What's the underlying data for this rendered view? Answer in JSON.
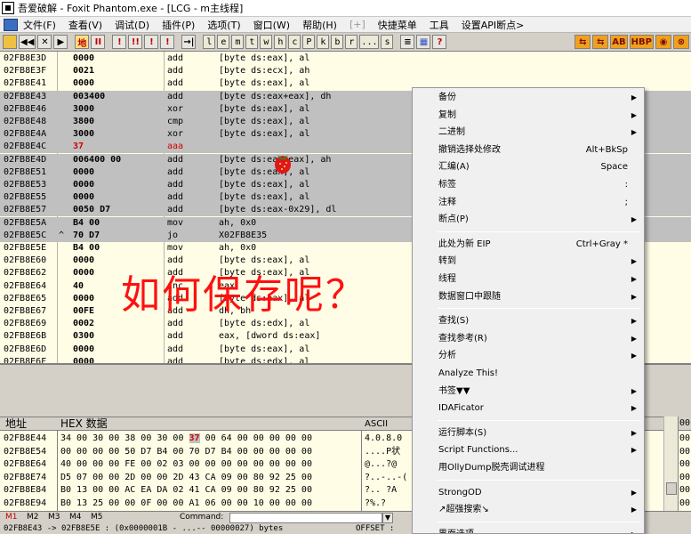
{
  "window": {
    "title": "吾爱破解 - Foxit Phantom.exe - [LCG - m主线程]"
  },
  "menubar": {
    "items": [
      "文件(F)",
      "查看(V)",
      "调试(D)",
      "插件(P)",
      "选项(T)",
      "窗口(W)",
      "帮助(H)",
      "[+]",
      "快捷菜单",
      "工具",
      "设置API断点>"
    ]
  },
  "toolbar": {
    "buttons": [
      "地",
      "II",
      "!",
      "!!",
      "!",
      "!",
      "→|",
      "l",
      "e",
      "m",
      "t",
      "w",
      "h",
      "c",
      "P",
      "k",
      "b",
      "r",
      "...",
      "s",
      "≡",
      "?"
    ],
    "plugin_buttons": [
      "⇆",
      "⇆",
      "AB",
      "HBP",
      "◉",
      "⊗"
    ]
  },
  "disassembly": {
    "rows": [
      {
        "addr": "02FB8E3D",
        "mark": "",
        "hex": "0000",
        "mnem": "add",
        "ops": "[byte ds:eax], al",
        "sel": false,
        "red": false
      },
      {
        "addr": "02FB8E3F",
        "mark": "",
        "hex": "0021",
        "mnem": "add",
        "ops": "[byte ds:ecx], ah",
        "sel": false,
        "red": false
      },
      {
        "addr": "02FB8E41",
        "mark": "",
        "hex": "0000",
        "mnem": "add",
        "ops": "[byte ds:eax], al",
        "sel": false,
        "red": false
      },
      {
        "addr": "02FB8E43",
        "mark": "",
        "hex": "003400",
        "mnem": "add",
        "ops": "[byte ds:eax+eax], dh",
        "sel": true,
        "red": false
      },
      {
        "addr": "02FB8E46",
        "mark": "",
        "hex": "3000",
        "mnem": "xor",
        "ops": "[byte ds:eax], al",
        "sel": true,
        "red": false
      },
      {
        "addr": "02FB8E48",
        "mark": "",
        "hex": "3800",
        "mnem": "cmp",
        "ops": "[byte ds:eax], al",
        "sel": true,
        "red": false
      },
      {
        "addr": "02FB8E4A",
        "mark": "",
        "hex": "3000",
        "mnem": "xor",
        "ops": "[byte ds:eax], al",
        "sel": true,
        "red": false
      },
      {
        "addr": "02FB8E4C",
        "mark": "",
        "hex": "37",
        "mnem": "aaa",
        "ops": "",
        "sel": true,
        "red": true
      },
      {
        "addr": "02FB8E4D",
        "mark": "",
        "hex": "006400 00",
        "mnem": "add",
        "ops": "[byte ds:eax+eax], ah",
        "sel": true,
        "red": false
      },
      {
        "addr": "02FB8E51",
        "mark": "",
        "hex": "0000",
        "mnem": "add",
        "ops": "[byte ds:eax], al",
        "sel": true,
        "red": false
      },
      {
        "addr": "02FB8E53",
        "mark": "",
        "hex": "0000",
        "mnem": "add",
        "ops": "[byte ds:eax], al",
        "sel": true,
        "red": false
      },
      {
        "addr": "02FB8E55",
        "mark": "",
        "hex": "0000",
        "mnem": "add",
        "ops": "[byte ds:eax], al",
        "sel": true,
        "red": false
      },
      {
        "addr": "02FB8E57",
        "mark": "",
        "hex": "0050 D7",
        "mnem": "add",
        "ops": "[byte ds:eax-0x29], dl",
        "sel": true,
        "red": false
      },
      {
        "addr": "02FB8E5A",
        "mark": "",
        "hex": "B4 00",
        "mnem": "mov",
        "ops": "ah, 0x0",
        "sel": true,
        "red": false
      },
      {
        "addr": "02FB8E5C",
        "mark": "^",
        "hex": "70 D7",
        "mnem": "jo",
        "ops": "X02FB8E35",
        "sel": true,
        "red": false
      },
      {
        "addr": "02FB8E5E",
        "mark": "",
        "hex": "B4 00",
        "mnem": "mov",
        "ops": "ah, 0x0",
        "sel": false,
        "red": false
      },
      {
        "addr": "02FB8E60",
        "mark": "",
        "hex": "0000",
        "mnem": "add",
        "ops": "[byte ds:eax], al",
        "sel": false,
        "red": false
      },
      {
        "addr": "02FB8E62",
        "mark": "",
        "hex": "0000",
        "mnem": "add",
        "ops": "[byte ds:eax], al",
        "sel": false,
        "red": false
      },
      {
        "addr": "02FB8E64",
        "mark": "",
        "hex": "40",
        "mnem": "inc",
        "ops": "eax",
        "sel": false,
        "red": false
      },
      {
        "addr": "02FB8E65",
        "mark": "",
        "hex": "0000",
        "mnem": "add",
        "ops": "[byte ds:eax], al",
        "sel": false,
        "red": false
      },
      {
        "addr": "02FB8E67",
        "mark": "",
        "hex": "00FE",
        "mnem": "add",
        "ops": "dh, bh",
        "sel": false,
        "red": false
      },
      {
        "addr": "02FB8E69",
        "mark": "",
        "hex": "0002",
        "mnem": "add",
        "ops": "[byte ds:edx], al",
        "sel": false,
        "red": false
      },
      {
        "addr": "02FB8E6B",
        "mark": "",
        "hex": "0300",
        "mnem": "add",
        "ops": "eax, [dword ds:eax]",
        "sel": false,
        "red": false
      },
      {
        "addr": "02FB8E6D",
        "mark": "",
        "hex": "0000",
        "mnem": "add",
        "ops": "[byte ds:eax], al",
        "sel": false,
        "red": false
      },
      {
        "addr": "02FB8E6F",
        "mark": "",
        "hex": "0000",
        "mnem": "add",
        "ops": "[byte ds:edx], al",
        "sel": false,
        "red": false
      }
    ]
  },
  "overlay": {
    "text": "如何保存呢？",
    "color": "#ff1010"
  },
  "dump": {
    "headers": {
      "address": "地址",
      "hex": "HEX 数据",
      "ascii": "ASCII"
    },
    "rows": [
      {
        "addr": "02FB8E44",
        "hex_pre": "34 00 30 00 38 00 30 00 ",
        "hex_hl": "37",
        "hex_post": " 00 64 00 00 00 00 00",
        "ascii": "4.0.8.0"
      },
      {
        "addr": "02FB8E54",
        "hex_pre": "00 00 00 00 50 D7 B4 00 70 D7 B4 00 00 00 00 00",
        "hex_hl": "",
        "hex_post": "",
        "ascii": "....P状"
      },
      {
        "addr": "02FB8E64",
        "hex_pre": "40 00 00 00 FE 00 02 03 00 00 00 00 00 00 00 00",
        "hex_hl": "",
        "hex_post": "",
        "ascii": "@...?@"
      },
      {
        "addr": "02FB8E74",
        "hex_pre": "D5 07 00 00 2D 00 00 2D 43 CA 09 00 80 92 25 00",
        "hex_hl": "",
        "hex_post": "",
        "ascii": "?..-..-("
      },
      {
        "addr": "02FB8E84",
        "hex_pre": "B0 13 00 00 AC EA DA 02 41 CA 09 00 80 92 25 00",
        "hex_hl": "",
        "hex_post": "",
        "ascii": "?..  ?A"
      },
      {
        "addr": "02FB8E94",
        "hex_pre": "B0 13 25 00 00 0F 00 00 A1 06 00 00 10 00 00 00",
        "hex_hl": "",
        "hex_post": "",
        "ascii": "?%.?"
      }
    ]
  },
  "stack": {
    "header": "00",
    "rows": [
      "00",
      "00",
      "00",
      "00",
      "00",
      "00"
    ]
  },
  "cmdbar": {
    "tabs": [
      "M1",
      "M2",
      "M3",
      "M4",
      "M5"
    ],
    "command_label": "Command:",
    "command_value": ""
  },
  "statusbar": {
    "text": "02FB8E43 -> 02FB8E5E : (0x0000001B - ...-- 00000027) bytes",
    "right": "OFFSET :"
  },
  "context_menu": {
    "items": [
      {
        "label": "备份",
        "shortcut": "",
        "submenu": true
      },
      {
        "label": "复制",
        "shortcut": "",
        "submenu": true
      },
      {
        "label": "二进制",
        "shortcut": "",
        "submenu": true
      },
      {
        "label": "撤销选择处修改",
        "shortcut": "Alt+BkSp",
        "submenu": false
      },
      {
        "label": "汇编(A)",
        "shortcut": "Space",
        "submenu": false
      },
      {
        "label": "标签",
        "shortcut": ":",
        "submenu": false
      },
      {
        "label": "注释",
        "shortcut": ";",
        "submenu": false
      },
      {
        "label": "断点(P)",
        "shortcut": "",
        "submenu": true
      },
      {
        "sep": true
      },
      {
        "label": "此处为新 EIP",
        "shortcut": "Ctrl+Gray *",
        "submenu": false
      },
      {
        "label": "转到",
        "shortcut": "",
        "submenu": true
      },
      {
        "label": "线程",
        "shortcut": "",
        "submenu": true
      },
      {
        "label": "数据窗口中跟随",
        "shortcut": "",
        "submenu": true
      },
      {
        "sep": true
      },
      {
        "label": "查找(S)",
        "shortcut": "",
        "submenu": true
      },
      {
        "label": "查找参考(R)",
        "shortcut": "",
        "submenu": true
      },
      {
        "label": "分析",
        "shortcut": "",
        "submenu": true
      },
      {
        "label": "Analyze This!",
        "shortcut": "",
        "submenu": false
      },
      {
        "label": "书签▼▼",
        "shortcut": "",
        "submenu": true
      },
      {
        "label": "IDAFicator",
        "shortcut": "",
        "submenu": true
      },
      {
        "sep": true
      },
      {
        "label": "运行脚本(S)",
        "shortcut": "",
        "submenu": true
      },
      {
        "label": "Script Functions...",
        "shortcut": "",
        "submenu": true
      },
      {
        "label": "用OllyDump脱壳调试进程",
        "shortcut": "",
        "submenu": false
      },
      {
        "sep": true
      },
      {
        "label": "StrongOD",
        "shortcut": "",
        "submenu": true
      },
      {
        "label": "↗超强搜索↘",
        "shortcut": "",
        "submenu": true
      },
      {
        "sep": true
      },
      {
        "label": "界面选项",
        "shortcut": "",
        "submenu": true
      }
    ]
  }
}
